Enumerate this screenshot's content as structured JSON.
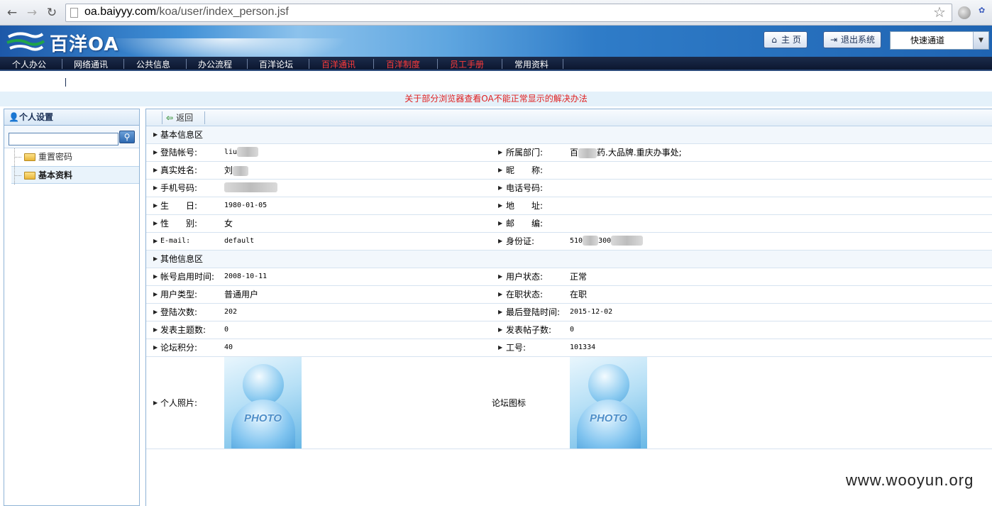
{
  "browser": {
    "url_host": "oa.baiyyy.com",
    "url_path": "/koa/user/index_person.jsf"
  },
  "header": {
    "logo_text": "百洋OA",
    "home_label": "主 页",
    "logout_label": "退出系统",
    "quick_select": "快速通道"
  },
  "menu": [
    {
      "label": "个人办公",
      "hot": false
    },
    {
      "label": "网络通讯",
      "hot": false
    },
    {
      "label": "公共信息",
      "hot": false
    },
    {
      "label": "办公流程",
      "hot": false
    },
    {
      "label": "百洋论坛",
      "hot": false
    },
    {
      "label": "百洋通讯",
      "hot": true
    },
    {
      "label": "百洋制度",
      "hot": true
    },
    {
      "label": "员工手册",
      "hot": true
    },
    {
      "label": "常用资料",
      "hot": false
    }
  ],
  "notice": "关于部分浏览器查看OA不能正常显示的解决办法",
  "sidebar": {
    "title": "个人设置",
    "search_value": "",
    "items": [
      {
        "label": "重置密码"
      },
      {
        "label": "基本资料"
      }
    ]
  },
  "toolbar": {
    "back_label": "返回"
  },
  "sections": {
    "basic": "基本信息区",
    "other": "其他信息区"
  },
  "fields": {
    "login_account": {
      "label": "登陆帐号:",
      "value": "liu"
    },
    "department": {
      "label": "所属部门:",
      "value_prefix": "百",
      "value_suffix": "药.大品牌.重庆办事处;"
    },
    "real_name": {
      "label": "真实姓名:",
      "value": "刘"
    },
    "nickname": {
      "label": "昵　　称:",
      "value": ""
    },
    "mobile": {
      "label": "手机号码:",
      "value": ""
    },
    "phone": {
      "label": "电话号码:",
      "value": ""
    },
    "birthday": {
      "label": "生　　日:",
      "value": "1980-01-05"
    },
    "address": {
      "label": "地　　址:",
      "value": ""
    },
    "gender": {
      "label": "性　　别:",
      "value": "女"
    },
    "zip": {
      "label": "邮　　编:",
      "value": ""
    },
    "email": {
      "label": "E-mail:",
      "value": "default"
    },
    "id_card": {
      "label": "身份证:",
      "value_a": "510",
      "value_b": "300"
    },
    "enable_time": {
      "label": "帐号启用时间:",
      "value": "2008-10-11"
    },
    "user_status": {
      "label": "用户状态:",
      "value": "正常"
    },
    "user_type": {
      "label": "用户类型:",
      "value": "普通用户"
    },
    "job_status": {
      "label": "在职状态:",
      "value": "在职"
    },
    "login_count": {
      "label": "登陆次数:",
      "value": "202"
    },
    "last_login": {
      "label": "最后登陆时间:",
      "value": "2015-12-02"
    },
    "topic_count": {
      "label": "发表主题数:",
      "value": "0"
    },
    "post_count": {
      "label": "发表帖子数:",
      "value": "0"
    },
    "forum_points": {
      "label": "论坛积分:",
      "value": "40"
    },
    "employee_no": {
      "label": "工号:",
      "value": "101334"
    },
    "personal_photo": {
      "label": "个人照片:"
    },
    "forum_icon": {
      "label": "论坛图标"
    }
  },
  "photo_text": "PHOTO",
  "watermark": "www.wooyun.org",
  "colors": {
    "menu_hot": "#ff3a3a",
    "notice": "#e02020",
    "banner": "#2f7cc8"
  }
}
